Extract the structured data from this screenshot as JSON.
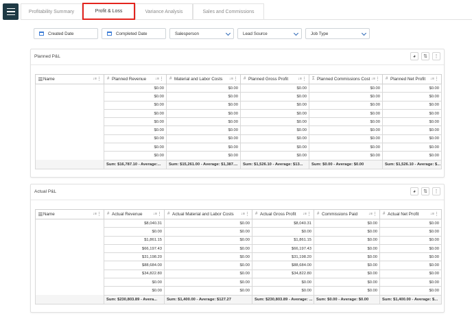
{
  "tabs": [
    "Profitability Summary",
    "Profit & Loss",
    "Variance Analysis",
    "Sales and Commissions"
  ],
  "filters": {
    "created_date": "Created Date",
    "completed_date": "Completed Date",
    "salesperson": "Salesperson",
    "lead_source": "Lead Source",
    "job_type": "Job Type"
  },
  "planned": {
    "title": "Planned P&L",
    "columns": [
      "Name",
      "Planned Revenue",
      "Material and Labor Costs",
      "Planned Gross Profit",
      "Planned Commissions Cost",
      "Planned Net Profit"
    ],
    "rows": [
      [
        "",
        "$0.00",
        "$0.00",
        "$0.00",
        "$0.00",
        "$0.00"
      ],
      [
        "",
        "$0.00",
        "$0.00",
        "$0.00",
        "$0.00",
        "$0.00"
      ],
      [
        "",
        "$0.00",
        "$0.00",
        "$0.00",
        "$0.00",
        "$0.00"
      ],
      [
        "",
        "$0.00",
        "$0.00",
        "$0.00",
        "$0.00",
        "$0.00"
      ],
      [
        "",
        "$0.00",
        "$0.00",
        "$0.00",
        "$0.00",
        "$0.00"
      ],
      [
        "",
        "$0.00",
        "$0.00",
        "$0.00",
        "$0.00",
        "$0.00"
      ],
      [
        "",
        "$0.00",
        "$0.00",
        "$0.00",
        "$0.00",
        "$0.00"
      ],
      [
        "",
        "$0.00",
        "$0.00",
        "$0.00",
        "$0.00",
        "$0.00"
      ],
      [
        "",
        "$0.00",
        "$0.00",
        "$0.00",
        "$0.00",
        "$0.00"
      ]
    ],
    "sums": [
      "",
      "Sum: $16,787.10 - Average:...",
      "Sum: $15,261.00 - Average: $1,387....",
      "Sum: $1,526.10 - Average: $13...",
      "Sum: $0.00 - Average: $0.00",
      "Sum: $1,526.10 - Average: $..."
    ]
  },
  "actual": {
    "title": "Actual P&L",
    "columns": [
      "Name",
      "Actual Revenue",
      "Actual Material and Labor Costs",
      "Actual Gross Profit",
      "Commissions Paid",
      "Actual Net Profit"
    ],
    "rows": [
      [
        "",
        "$8,040.31",
        "$0.00",
        "$8,040.31",
        "$0.00",
        "$0.00"
      ],
      [
        "",
        "$0.00",
        "$0.00",
        "$0.00",
        "$0.00",
        "$0.00"
      ],
      [
        "",
        "$1,861.15",
        "$0.00",
        "$1,861.15",
        "$0.00",
        "$0.00"
      ],
      [
        "",
        "$66,197.43",
        "$0.00",
        "$66,197.43",
        "$0.00",
        "$0.00"
      ],
      [
        "",
        "$31,198.20",
        "$0.00",
        "$31,198.20",
        "$0.00",
        "$0.00"
      ],
      [
        "",
        "$88,684.00",
        "$0.00",
        "$88,684.00",
        "$0.00",
        "$0.00"
      ],
      [
        "",
        "$34,822.80",
        "$0.00",
        "$34,822.80",
        "$0.00",
        "$0.00"
      ],
      [
        "",
        "$0.00",
        "$0.00",
        "$0.00",
        "$0.00",
        "$0.00"
      ],
      [
        "",
        "$0.00",
        "$0.00",
        "$0.00",
        "$0.00",
        "$0.00"
      ]
    ],
    "sums": [
      "",
      "Sum: $230,803.89 - Avera...",
      "Sum: $1,400.00 - Average: $127.27",
      "Sum: $230,803.89 - Average: ...",
      "Sum: $0.00 - Average: $0.00",
      "Sum: $1,400.00 - Average: $..."
    ]
  },
  "colors": {
    "menu_bg": "#1e3a45",
    "active_tab_border": "#e3241e",
    "accent": "#2864b4"
  },
  "icons": {
    "visibility": "eye-icon",
    "sort": "swap-vertical-icon",
    "more": "kebab-menu-icon"
  }
}
